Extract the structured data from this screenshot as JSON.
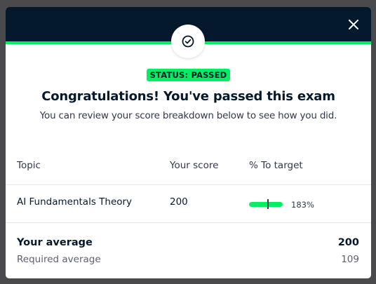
{
  "modal": {
    "status_label": "STATUS: PASSED",
    "title": "Congratulations! You've passed this exam",
    "subtitle": "You can review your score breakdown below to see how you did.",
    "accent_color": "#03ef62",
    "header_color": "#05192d",
    "close_icon": "close-icon",
    "badge_icon": "check-circle-icon"
  },
  "table": {
    "headers": [
      "Topic",
      "Your score",
      "% To target"
    ],
    "rows": [
      {
        "topic": "AI Fundamentals Theory",
        "score": "200",
        "percent_label": "183%",
        "progress_fraction": 1.0
      }
    ]
  },
  "summary": {
    "average_label": "Your average",
    "average_value": "200",
    "required_label": "Required average",
    "required_value": "109"
  }
}
